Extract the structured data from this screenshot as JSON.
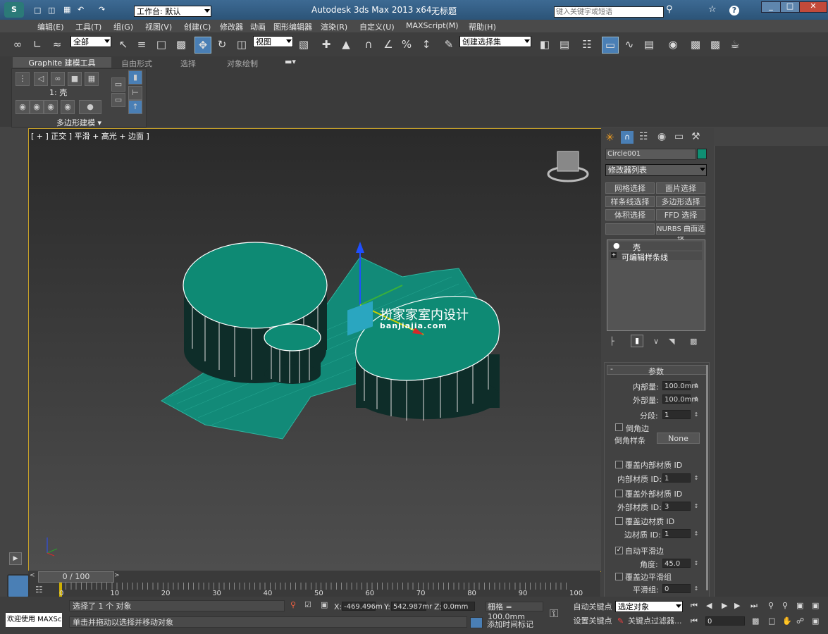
{
  "titlebar": {
    "workspace_label": "工作台: 默认",
    "app_title": "Autodesk 3ds Max  2013 x64",
    "doc_title": "无标题",
    "search_placeholder": "键入关键字或短语"
  },
  "menu": {
    "items": [
      "编辑(E)",
      "工具(T)",
      "组(G)",
      "视图(V)",
      "创建(C)",
      "修改器",
      "动画",
      "图形编辑器",
      "渲染(R)",
      "自定义(U)",
      "MAXScript(M)",
      "帮助(H)"
    ]
  },
  "toolbar": {
    "filter_select": "全部",
    "ref_coord_select": "视图",
    "named_selection": "创建选择集"
  },
  "ribbon": {
    "tabs": [
      "Graphite 建模工具",
      "自由形式",
      "选择",
      "对象绘制"
    ],
    "level_label": "1: 壳",
    "panel_label": "多边形建模"
  },
  "viewport": {
    "label": "[ + ] 正交 ] 平滑 + 高光 + 边面 ]",
    "watermark_title": "扮家家室内设计",
    "watermark_url": "banjiajia.com",
    "colors": {
      "object": "#1f8f7f",
      "background_top": "#2a2a2a",
      "background_bottom": "#4e4e4e"
    }
  },
  "command_panel": {
    "object_name": "Circle001",
    "object_color": "#0f8f73",
    "modifier_list": "修改器列表",
    "modifier_buttons": [
      "网格选择",
      "面片选择",
      "样条线选择",
      "多边形选择",
      "体积选择",
      "FFD 选择",
      "NURBS 曲面选择"
    ],
    "stack": [
      "壳",
      "可编辑样条线"
    ],
    "rollout_title": "参数",
    "params": {
      "inner_amount_label": "内部量:",
      "inner_amount": "100.0mm",
      "outer_amount_label": "外部量:",
      "outer_amount": "100.0mm",
      "segments_label": "分段:",
      "segments": "1",
      "bevel_edges_label": "倒角边",
      "bevel_spline_label": "倒角样条",
      "bevel_spline_value": "None",
      "override_inner_label": "覆盖内部材质 ID",
      "inner_mat_label": "内部材质 ID:",
      "inner_mat": "1",
      "override_outer_label": "覆盖外部材质 ID",
      "outer_mat_label": "外部材质 ID:",
      "outer_mat": "3",
      "override_edge_label": "覆盖边材质 ID",
      "edge_mat_label": "边材质 ID:",
      "edge_mat": "1",
      "auto_smooth_label": "自动平滑边",
      "angle_label": "角度:",
      "angle": "45.0",
      "override_smooth_label": "覆盖边平滑组",
      "smooth_group_label": "平滑组:",
      "smooth_group": "0"
    }
  },
  "timeline": {
    "frame_label": "0 / 100",
    "ticks": [
      "0",
      "10",
      "20",
      "30",
      "40",
      "50",
      "60",
      "70",
      "80",
      "90",
      "100"
    ]
  },
  "status": {
    "welcome": "欢迎使用 MAXSc",
    "selected": "选择了 1 个 对象",
    "hint": "单击并拖动以选择并移动对象",
    "x_label": "X:",
    "x_value": "-469.496m",
    "y_label": "Y:",
    "y_value": "542.987mr",
    "z_label": "Z:",
    "z_value": "0.0mm",
    "grid": "栅格 = 100.0mm",
    "add_time_tag": "添加时间标记",
    "auto_key": "自动关键点",
    "selected_objects": "选定对象",
    "set_key": "设置关键点",
    "key_filters": "关键点过滤器...",
    "frame_spinner": "0"
  }
}
